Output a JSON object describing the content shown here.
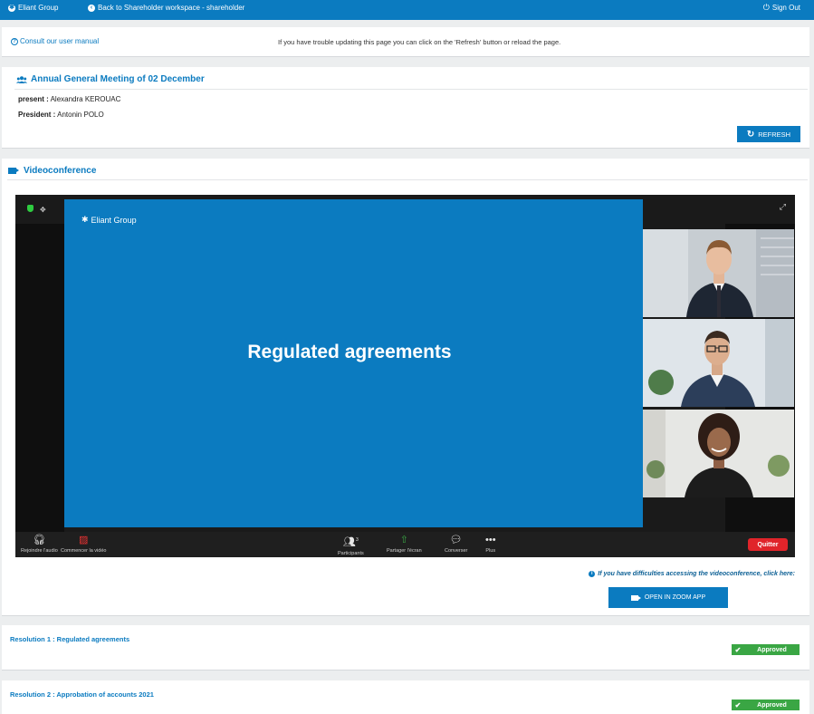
{
  "header": {
    "brand": "Eliant Group",
    "back_label": "Back to Shareholder workspace - shareholder",
    "signout_label": "Sign Out"
  },
  "help": {
    "manual_link": "Consult our user manual",
    "refresh_note": "If you have trouble updating this page you can click on the 'Refresh' button or reload the page."
  },
  "meeting": {
    "title": "Annual General Meeting of 02 December",
    "present_label": "present :",
    "present_value": "Alexandra KEROUAC",
    "president_label": "President :",
    "president_value": "Antonin POLO",
    "refresh_button": "REFRESH"
  },
  "videoconference": {
    "title": "Videoconference",
    "slide_brand": "Eliant Group",
    "slide_caption": "Regulated agreements",
    "toolbar": {
      "audio": "Rejoindre l'audio",
      "video": "Commencer la vidéo",
      "participants": "Participants",
      "participants_count": "3",
      "share": "Partager l'écran",
      "chat": "Converser",
      "more": "Plus",
      "quit": "Quitter"
    },
    "difficulty_note": "If you have difficulties accessing the videoconference, click here:",
    "open_zoom_button": "OPEN IN ZOOM APP"
  },
  "resolutions": [
    {
      "title": "Resolution 1 : Regulated agreements",
      "status": "Approved"
    },
    {
      "title": "Resolution 2 : Approbation of accounts 2021",
      "status": "Approved"
    }
  ],
  "colors": {
    "primary": "#0b7bc0",
    "approved": "#3aa644",
    "quit": "#e0242a"
  }
}
